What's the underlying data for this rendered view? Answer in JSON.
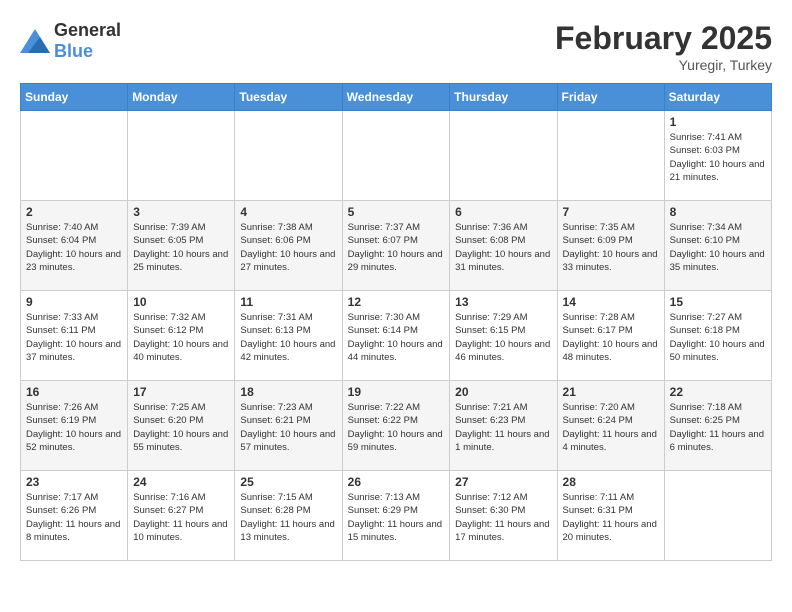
{
  "logo": {
    "general": "General",
    "blue": "Blue"
  },
  "header": {
    "month": "February 2025",
    "location": "Yuregir, Turkey"
  },
  "weekdays": [
    "Sunday",
    "Monday",
    "Tuesday",
    "Wednesday",
    "Thursday",
    "Friday",
    "Saturday"
  ],
  "weeks": [
    [
      null,
      null,
      null,
      null,
      null,
      null,
      {
        "day": 1,
        "sunrise": "7:41 AM",
        "sunset": "6:03 PM",
        "daylight": "10 hours and 21 minutes."
      }
    ],
    [
      {
        "day": 2,
        "sunrise": "7:40 AM",
        "sunset": "6:04 PM",
        "daylight": "10 hours and 23 minutes."
      },
      {
        "day": 3,
        "sunrise": "7:39 AM",
        "sunset": "6:05 PM",
        "daylight": "10 hours and 25 minutes."
      },
      {
        "day": 4,
        "sunrise": "7:38 AM",
        "sunset": "6:06 PM",
        "daylight": "10 hours and 27 minutes."
      },
      {
        "day": 5,
        "sunrise": "7:37 AM",
        "sunset": "6:07 PM",
        "daylight": "10 hours and 29 minutes."
      },
      {
        "day": 6,
        "sunrise": "7:36 AM",
        "sunset": "6:08 PM",
        "daylight": "10 hours and 31 minutes."
      },
      {
        "day": 7,
        "sunrise": "7:35 AM",
        "sunset": "6:09 PM",
        "daylight": "10 hours and 33 minutes."
      },
      {
        "day": 8,
        "sunrise": "7:34 AM",
        "sunset": "6:10 PM",
        "daylight": "10 hours and 35 minutes."
      }
    ],
    [
      {
        "day": 9,
        "sunrise": "7:33 AM",
        "sunset": "6:11 PM",
        "daylight": "10 hours and 37 minutes."
      },
      {
        "day": 10,
        "sunrise": "7:32 AM",
        "sunset": "6:12 PM",
        "daylight": "10 hours and 40 minutes."
      },
      {
        "day": 11,
        "sunrise": "7:31 AM",
        "sunset": "6:13 PM",
        "daylight": "10 hours and 42 minutes."
      },
      {
        "day": 12,
        "sunrise": "7:30 AM",
        "sunset": "6:14 PM",
        "daylight": "10 hours and 44 minutes."
      },
      {
        "day": 13,
        "sunrise": "7:29 AM",
        "sunset": "6:15 PM",
        "daylight": "10 hours and 46 minutes."
      },
      {
        "day": 14,
        "sunrise": "7:28 AM",
        "sunset": "6:17 PM",
        "daylight": "10 hours and 48 minutes."
      },
      {
        "day": 15,
        "sunrise": "7:27 AM",
        "sunset": "6:18 PM",
        "daylight": "10 hours and 50 minutes."
      }
    ],
    [
      {
        "day": 16,
        "sunrise": "7:26 AM",
        "sunset": "6:19 PM",
        "daylight": "10 hours and 52 minutes."
      },
      {
        "day": 17,
        "sunrise": "7:25 AM",
        "sunset": "6:20 PM",
        "daylight": "10 hours and 55 minutes."
      },
      {
        "day": 18,
        "sunrise": "7:23 AM",
        "sunset": "6:21 PM",
        "daylight": "10 hours and 57 minutes."
      },
      {
        "day": 19,
        "sunrise": "7:22 AM",
        "sunset": "6:22 PM",
        "daylight": "10 hours and 59 minutes."
      },
      {
        "day": 20,
        "sunrise": "7:21 AM",
        "sunset": "6:23 PM",
        "daylight": "11 hours and 1 minute."
      },
      {
        "day": 21,
        "sunrise": "7:20 AM",
        "sunset": "6:24 PM",
        "daylight": "11 hours and 4 minutes."
      },
      {
        "day": 22,
        "sunrise": "7:18 AM",
        "sunset": "6:25 PM",
        "daylight": "11 hours and 6 minutes."
      }
    ],
    [
      {
        "day": 23,
        "sunrise": "7:17 AM",
        "sunset": "6:26 PM",
        "daylight": "11 hours and 8 minutes."
      },
      {
        "day": 24,
        "sunrise": "7:16 AM",
        "sunset": "6:27 PM",
        "daylight": "11 hours and 10 minutes."
      },
      {
        "day": 25,
        "sunrise": "7:15 AM",
        "sunset": "6:28 PM",
        "daylight": "11 hours and 13 minutes."
      },
      {
        "day": 26,
        "sunrise": "7:13 AM",
        "sunset": "6:29 PM",
        "daylight": "11 hours and 15 minutes."
      },
      {
        "day": 27,
        "sunrise": "7:12 AM",
        "sunset": "6:30 PM",
        "daylight": "11 hours and 17 minutes."
      },
      {
        "day": 28,
        "sunrise": "7:11 AM",
        "sunset": "6:31 PM",
        "daylight": "11 hours and 20 minutes."
      },
      null
    ]
  ]
}
